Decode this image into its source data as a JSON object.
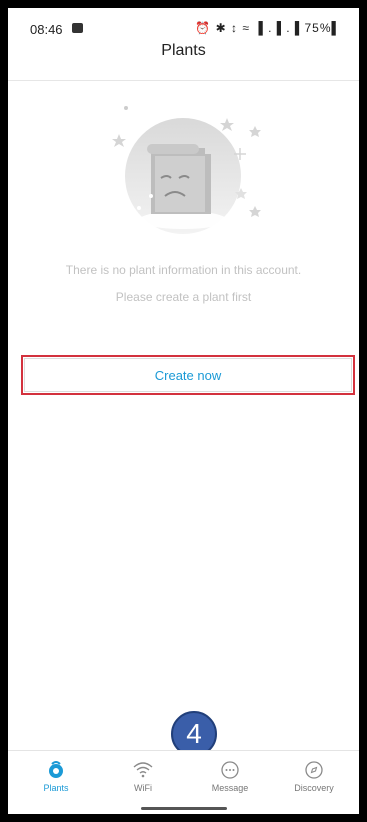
{
  "status_bar": {
    "time": "08:46",
    "system_icons": "⏰ ✱ ↕ ≈ ▐ .▐ .▐ 75%▌",
    "battery": "75%"
  },
  "header": {
    "title": "Plants"
  },
  "empty_state": {
    "illustration": "empty-scroll-face-icon",
    "line1": "There is no plant information in this account.",
    "line2": "Please create a plant first"
  },
  "create_button": {
    "label": "Create now"
  },
  "annotation": {
    "step_number": "4",
    "highlight_color": "#d3313d",
    "badge_color": "#3a5ea9"
  },
  "tabbar": {
    "tabs": [
      {
        "label": "Plants",
        "icon": "plant-icon",
        "active": true
      },
      {
        "label": "WiFi",
        "icon": "wifi-icon",
        "active": false
      },
      {
        "label": "Message",
        "icon": "message-icon",
        "active": false
      },
      {
        "label": "Discovery",
        "icon": "compass-icon",
        "active": false
      }
    ]
  },
  "colors": {
    "accent": "#1b9ad6",
    "muted_text": "#c2c2c2"
  }
}
